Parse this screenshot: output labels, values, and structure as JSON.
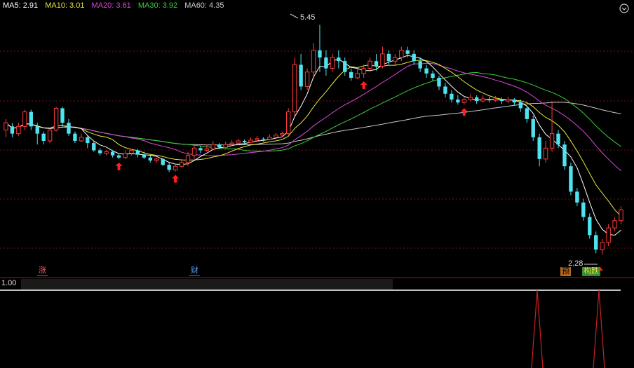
{
  "legend": {
    "ma5": "MA5: 2.91",
    "ma10": "MA10: 3.01",
    "ma20": "MA20: 3.61",
    "ma30": "MA30: 3.92",
    "ma60": "MA60: 4.35"
  },
  "colors": {
    "up": "#ff3b3b",
    "down": "#4fe3f0",
    "ma5": "#ffffff",
    "ma10": "#e8e83a",
    "ma20": "#d84ad8",
    "ma30": "#3ccd3c",
    "ma60": "#c8c8c8",
    "arrow": "#ff2020"
  },
  "annotations": {
    "high": "5.45",
    "low": "2.28"
  },
  "tags": {
    "zhang": "涨",
    "cai": "财",
    "yu": "预",
    "die": "跌",
    "die_prefix": "构"
  },
  "sub_indicator": {
    "value": "1.00"
  },
  "icons": {
    "top_right": "settings-icon"
  },
  "chart_data": {
    "type": "candlestick",
    "high_label": 5.45,
    "low_label": 2.28,
    "ylim": [
      2.1,
      5.6
    ],
    "candles": [
      [
        4.0,
        4.1,
        4.15,
        3.9
      ],
      [
        4.05,
        3.95,
        4.1,
        3.9
      ],
      [
        3.95,
        4.05,
        4.1,
        3.92
      ],
      [
        4.05,
        4.25,
        4.28,
        4.0
      ],
      [
        4.25,
        4.05,
        4.28,
        4.0
      ],
      [
        4.05,
        3.95,
        4.1,
        3.8
      ],
      [
        3.95,
        3.85,
        3.98,
        3.8
      ],
      [
        3.85,
        4.0,
        4.02,
        3.82
      ],
      [
        4.0,
        4.3,
        4.32,
        3.98
      ],
      [
        4.3,
        4.1,
        4.32,
        4.05
      ],
      [
        4.1,
        3.95,
        4.15,
        3.92
      ],
      [
        3.95,
        3.85,
        3.98,
        3.82
      ],
      [
        3.85,
        3.9,
        3.95,
        3.83
      ],
      [
        3.9,
        3.82,
        3.92,
        3.75
      ],
      [
        3.82,
        3.72,
        3.85,
        3.7
      ],
      [
        3.72,
        3.68,
        3.75,
        3.65
      ],
      [
        3.68,
        3.7,
        3.72,
        3.65
      ],
      [
        3.7,
        3.65,
        3.72,
        3.62
      ],
      [
        3.65,
        3.62,
        3.68,
        3.6
      ],
      [
        3.62,
        3.68,
        3.72,
        3.6
      ],
      [
        3.68,
        3.72,
        3.74,
        3.65
      ],
      [
        3.72,
        3.66,
        3.74,
        3.62
      ],
      [
        3.66,
        3.62,
        3.7,
        3.6
      ],
      [
        3.62,
        3.58,
        3.65,
        3.55
      ],
      [
        3.58,
        3.6,
        3.62,
        3.55
      ],
      [
        3.6,
        3.52,
        3.62,
        3.5
      ],
      [
        3.52,
        3.45,
        3.55,
        3.42
      ],
      [
        3.45,
        3.5,
        3.52,
        3.43
      ],
      [
        3.5,
        3.55,
        3.6,
        3.48
      ],
      [
        3.55,
        3.65,
        3.7,
        3.5
      ],
      [
        3.65,
        3.75,
        3.78,
        3.6
      ],
      [
        3.75,
        3.72,
        3.78,
        3.68
      ],
      [
        3.72,
        3.74,
        3.8,
        3.7
      ],
      [
        3.74,
        3.8,
        3.85,
        3.72
      ],
      [
        3.8,
        3.76,
        3.82,
        3.74
      ],
      [
        3.76,
        3.8,
        3.84,
        3.74
      ],
      [
        3.8,
        3.82,
        3.86,
        3.78
      ],
      [
        3.82,
        3.85,
        3.88,
        3.8
      ],
      [
        3.85,
        3.83,
        3.87,
        3.8
      ],
      [
        3.83,
        3.86,
        3.9,
        3.82
      ],
      [
        3.86,
        3.88,
        3.92,
        3.84
      ],
      [
        3.88,
        3.87,
        3.9,
        3.84
      ],
      [
        3.87,
        3.9,
        3.94,
        3.86
      ],
      [
        3.9,
        3.93,
        3.96,
        3.88
      ],
      [
        3.93,
        3.95,
        3.98,
        3.9
      ],
      [
        3.95,
        4.25,
        4.3,
        3.92
      ],
      [
        4.25,
        4.9,
        5.0,
        4.2
      ],
      [
        4.9,
        4.6,
        5.05,
        4.55
      ],
      [
        4.6,
        4.8,
        4.85,
        4.55
      ],
      [
        4.8,
        5.1,
        5.2,
        4.75
      ],
      [
        5.1,
        5.0,
        5.45,
        4.8
      ],
      [
        5.0,
        4.85,
        5.1,
        4.75
      ],
      [
        4.85,
        5.0,
        5.05,
        4.8
      ],
      [
        5.0,
        4.95,
        5.1,
        4.85
      ],
      [
        4.95,
        4.8,
        5.0,
        4.75
      ],
      [
        4.8,
        4.72,
        4.85,
        4.68
      ],
      [
        4.72,
        4.78,
        4.85,
        4.7
      ],
      [
        4.78,
        4.85,
        4.9,
        4.72
      ],
      [
        4.85,
        4.95,
        5.0,
        4.8
      ],
      [
        4.95,
        4.88,
        5.05,
        4.82
      ],
      [
        4.88,
        5.05,
        5.15,
        4.85
      ],
      [
        5.05,
        4.95,
        5.1,
        4.9
      ],
      [
        4.95,
        5.0,
        5.05,
        4.9
      ],
      [
        5.0,
        5.1,
        5.15,
        4.95
      ],
      [
        5.1,
        5.05,
        5.15,
        5.0
      ],
      [
        5.05,
        4.95,
        5.1,
        4.9
      ],
      [
        4.95,
        4.85,
        5.0,
        4.8
      ],
      [
        4.85,
        4.78,
        4.9,
        4.72
      ],
      [
        4.78,
        4.72,
        4.82,
        4.68
      ],
      [
        4.72,
        4.6,
        4.75,
        4.55
      ],
      [
        4.6,
        4.5,
        4.65,
        4.45
      ],
      [
        4.5,
        4.42,
        4.55,
        4.38
      ],
      [
        4.42,
        4.38,
        4.48,
        4.35
      ],
      [
        4.38,
        4.42,
        4.45,
        4.35
      ],
      [
        4.42,
        4.45,
        4.5,
        4.4
      ],
      [
        4.45,
        4.4,
        4.48,
        4.36
      ],
      [
        4.4,
        4.43,
        4.48,
        4.38
      ],
      [
        4.43,
        4.41,
        4.46,
        4.38
      ],
      [
        4.41,
        4.43,
        4.47,
        4.39
      ],
      [
        4.43,
        4.4,
        4.45,
        4.36
      ],
      [
        4.4,
        4.42,
        4.46,
        4.37
      ],
      [
        4.42,
        4.38,
        4.44,
        4.34
      ],
      [
        4.38,
        4.3,
        4.42,
        4.25
      ],
      [
        4.3,
        4.15,
        4.33,
        4.1
      ],
      [
        4.15,
        3.9,
        4.2,
        3.85
      ],
      [
        3.9,
        3.6,
        3.95,
        3.5
      ],
      [
        3.6,
        3.75,
        3.85,
        3.55
      ],
      [
        3.75,
        3.95,
        4.4,
        3.7
      ],
      [
        3.95,
        3.8,
        4.0,
        3.75
      ],
      [
        3.8,
        3.5,
        3.85,
        3.45
      ],
      [
        3.5,
        3.15,
        3.55,
        3.1
      ],
      [
        3.15,
        3.0,
        3.2,
        2.95
      ],
      [
        3.0,
        2.8,
        3.05,
        2.75
      ],
      [
        2.8,
        2.55,
        2.85,
        2.5
      ],
      [
        2.55,
        2.35,
        2.6,
        2.3
      ],
      [
        2.35,
        2.45,
        2.5,
        2.28
      ],
      [
        2.45,
        2.65,
        2.7,
        2.4
      ],
      [
        2.65,
        2.75,
        2.8,
        2.6
      ],
      [
        2.75,
        2.9,
        2.95,
        2.7
      ]
    ]
  }
}
